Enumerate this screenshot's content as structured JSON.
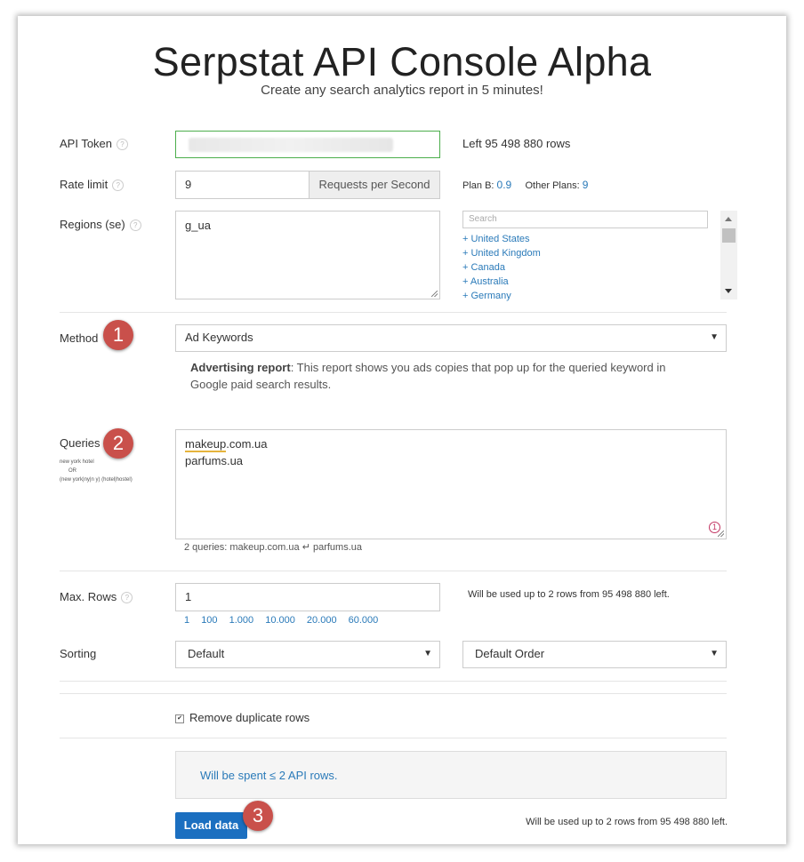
{
  "header": {
    "title": "Serpstat API Console Alpha",
    "subtitle": "Create any search analytics report in 5 minutes!"
  },
  "api_token": {
    "label": "API Token",
    "help": "?",
    "left_text": "Left 95 498 880 rows"
  },
  "rate_limit": {
    "label": "Rate limit",
    "help": "?",
    "value": "9",
    "addon": "Requests per Second",
    "plan_b_label": "Plan B:",
    "plan_b_value": "0.9",
    "other_label": "Other Plans:",
    "other_value": "9"
  },
  "regions": {
    "label": "Regions (se)",
    "help": "?",
    "value": "g_ua",
    "search_placeholder": "Search",
    "items": [
      "+ United States",
      "+ United Kingdom",
      "+ Canada",
      "+ Australia",
      "+ Germany"
    ]
  },
  "method": {
    "label": "Method",
    "badge": "1",
    "selected": "Ad Keywords",
    "caret": "▼",
    "desc_bold": "Advertising report",
    "desc_text": ": This report shows you ads copies that pop up for the queried keyword in Google paid search results."
  },
  "queries": {
    "label": "Queries",
    "badge": "2",
    "hint_line1": "new york hotel",
    "hint_line2": "OR",
    "hint_line3": "(new york|ny|n y) (hotel|hostel)",
    "line1": "makeup.com.ua",
    "line1_underlined": "makeup",
    "line1_rest": ".com.ua",
    "line2": "parfums.ua",
    "counter": "1",
    "info_count": "2",
    "info_text": " queries: makeup.com.ua ↵ parfums.ua"
  },
  "max_rows": {
    "label": "Max. Rows",
    "help": "?",
    "value": "1",
    "note": "Will be used up to 2 rows from 95 498 880 left.",
    "quick": [
      "1",
      "100",
      "1.000",
      "10.000",
      "20.000",
      "60.000"
    ]
  },
  "sorting": {
    "label": "Sorting",
    "field": "Default",
    "order": "Default Order",
    "caret": "▼"
  },
  "options": {
    "remove_duplicates": "Remove duplicate rows",
    "check_mark": "✔"
  },
  "summary": {
    "spent": "Will be spent ≤ 2 API rows."
  },
  "actions": {
    "load_label": "Load data",
    "badge": "3",
    "note": "Will be used up to 2 rows from 95 498 880 left."
  }
}
